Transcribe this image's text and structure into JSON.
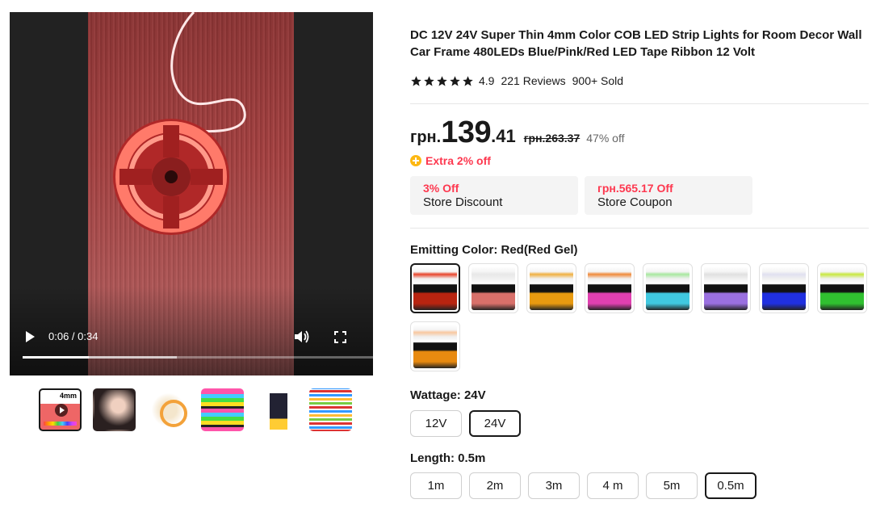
{
  "video": {
    "time_display": "0:06 / 0:34",
    "progress_fraction": 0.19,
    "buffered_fraction": 0.44
  },
  "thumbnails": [
    {
      "name": "thumb-video",
      "label": "4mm",
      "active": true
    },
    {
      "name": "thumb-2"
    },
    {
      "name": "thumb-3"
    },
    {
      "name": "thumb-4"
    },
    {
      "name": "thumb-5"
    },
    {
      "name": "thumb-6"
    }
  ],
  "product": {
    "title": "DC 12V 24V Super Thin 4mm Color COB LED Strip Lights for Room Decor Wall Car Frame 480LEDs Blue/Pink/Red LED Tape Ribbon 12 Volt",
    "rating": "4.9",
    "stars": 5,
    "reviews": "221 Reviews",
    "sold": "900+ Sold"
  },
  "price": {
    "currency": "грн.",
    "whole": "139",
    "decimal": ".41",
    "original": "грн.263.37",
    "discount": "47% off",
    "extra": "Extra 2% off"
  },
  "coupons": [
    {
      "title": "3% Off",
      "subtitle": "Store Discount"
    },
    {
      "title": "грн.565.17 Off",
      "subtitle": "Store Coupon"
    }
  ],
  "emitting_color": {
    "label": "Emitting Color: Red(Red Gel)",
    "options": [
      {
        "name": "red",
        "top": "#e8452c",
        "bottom": "#b82410",
        "selected": true
      },
      {
        "name": "pink-white",
        "top": "#e8e8e8",
        "bottom": "#d8706a",
        "selected": false
      },
      {
        "name": "warm-white",
        "top": "#f0b040",
        "bottom": "#e89a10",
        "selected": false
      },
      {
        "name": "pink",
        "top": "#f08a3a",
        "bottom": "#e040b0",
        "selected": false
      },
      {
        "name": "ice-blue",
        "top": "#a8e8a0",
        "bottom": "#40c8e0",
        "selected": false
      },
      {
        "name": "purple",
        "top": "#e0e0e0",
        "bottom": "#9a70e0",
        "selected": false
      },
      {
        "name": "blue",
        "top": "#e0e0f0",
        "bottom": "#2030e0",
        "selected": false
      },
      {
        "name": "green",
        "top": "#c8e840",
        "bottom": "#30c030",
        "selected": false
      },
      {
        "name": "orange",
        "top": "#f8c8a0",
        "bottom": "#e88a10",
        "selected": false
      }
    ]
  },
  "wattage": {
    "label": "Wattage: 24V",
    "options": [
      {
        "label": "12V",
        "selected": false
      },
      {
        "label": "24V",
        "selected": true
      }
    ]
  },
  "length": {
    "label": "Length: 0.5m",
    "options": [
      {
        "label": "1m",
        "selected": false
      },
      {
        "label": "2m",
        "selected": false
      },
      {
        "label": "3m",
        "selected": false
      },
      {
        "label": "4 m",
        "selected": false
      },
      {
        "label": "5m",
        "selected": false
      },
      {
        "label": "0.5m",
        "selected": true
      }
    ]
  }
}
